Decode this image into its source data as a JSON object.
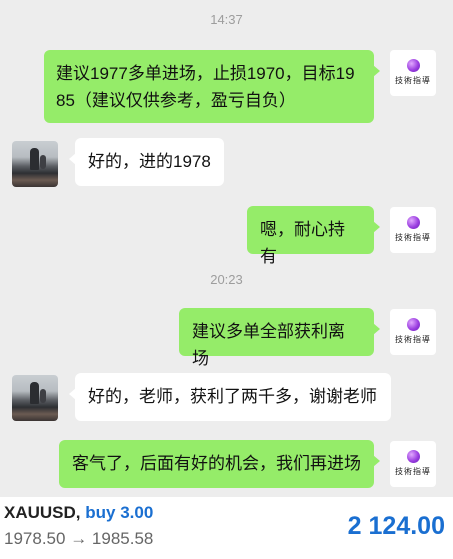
{
  "timestamps": [
    "14:37",
    "20:23"
  ],
  "messages": [
    {
      "side": "me",
      "text_line1": "建议1977多单进场，止损1970，目标19",
      "text_line2": "85（建议仅供参考，盈亏自负）"
    },
    {
      "side": "them",
      "text": "好的，进的1978"
    },
    {
      "side": "me",
      "text": "嗯，耐心持有"
    },
    {
      "side": "me",
      "text": "建议多单全部获利离场"
    },
    {
      "side": "them",
      "text": "好的，老师，获利了两千多，谢谢老师"
    },
    {
      "side": "me",
      "text": "客气了，后面有好的机会，我们再进场"
    }
  ],
  "my_avatar_logo_text": "技術指導",
  "trade": {
    "symbol": "XAUUSD,",
    "side": "buy 3.00",
    "open_price": "1978.50",
    "arrow": "→",
    "close_price": "1985.58",
    "profit": "2 124.00"
  },
  "colors": {
    "background": "#ededed",
    "my_bubble": "#95ec69",
    "their_bubble": "#ffffff",
    "profit_blue": "#1a6fd1"
  }
}
